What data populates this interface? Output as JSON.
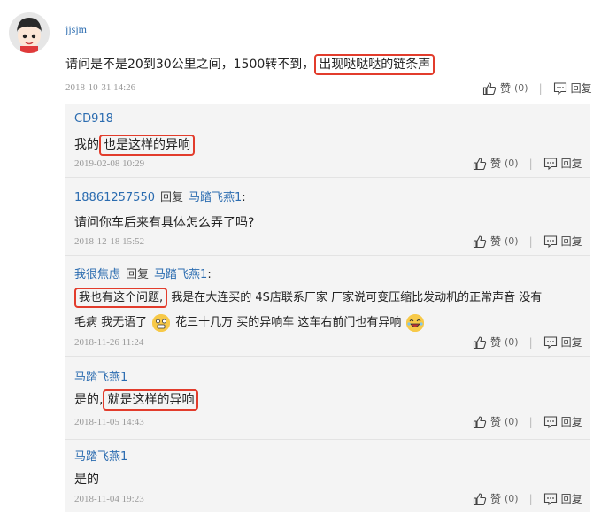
{
  "main_comment": {
    "author": "jjsjm",
    "text_before": "请问是不是20到30公里之间，1500转不到，",
    "text_highlight": "出现哒哒哒的链条声",
    "date": "2018-10-31 14:26",
    "like_label": "赞",
    "like_count": "(0)",
    "reply_label": "回复"
  },
  "replies": [
    {
      "author": "CD918",
      "reply_word": "",
      "target": "",
      "text_before": "我的",
      "text_highlight": "也是这样的异响",
      "text_after": "",
      "date": "2019-02-08 10:29",
      "like_label": "赞",
      "like_count": "(0)",
      "reply_label": "回复"
    },
    {
      "author": "18861257550",
      "reply_word": "回复",
      "target": "马踏飞燕1",
      "colon": ":",
      "text_before": "请问你车后来有具体怎么弄了吗?",
      "date": "2018-12-18 15:52",
      "like_label": "赞",
      "like_count": "(0)",
      "reply_label": "回复"
    },
    {
      "author": "我很焦虑",
      "reply_word": "回复",
      "target": "马踏飞燕1",
      "colon": ":",
      "text_highlight": "我也有这个问题,",
      "line1_after": "我是在大连买的 4S店联系厂家 厂家说可变压缩比发动机的正常声音 没有",
      "line2_a": "毛病 我无语了",
      "line2_b": "花三十几万 买的异响车 这车右前门也有异响",
      "date": "2018-11-26 11:24",
      "like_label": "赞",
      "like_count": "(0)",
      "reply_label": "回复"
    },
    {
      "author": "马踏飞燕1",
      "text_before": "是的,",
      "text_highlight": "就是这样的异响",
      "date": "2018-11-05 14:43",
      "like_label": "赞",
      "like_count": "(0)",
      "reply_label": "回复"
    },
    {
      "author": "马踏飞燕1",
      "text_before": "是的",
      "date": "2018-11-04 19:23",
      "like_label": "赞",
      "like_count": "(0)",
      "reply_label": "回复"
    }
  ],
  "colors": {
    "link_blue": "#2b6cb0",
    "highlight_red": "#e23c2c",
    "reply_bg": "#f4f4f4"
  },
  "icons": {
    "like": "thumbs-up-icon",
    "reply": "comment-icon",
    "emoji_1": "shocked-face-emoji",
    "emoji_2": "laughing-face-emoji"
  }
}
